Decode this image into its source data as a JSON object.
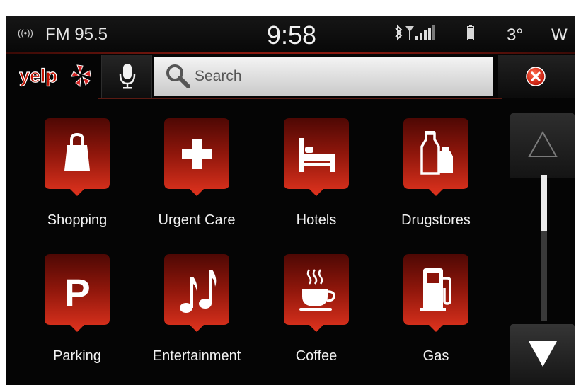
{
  "status_bar": {
    "radio_icon": "radio-signal-icon",
    "station": "FM 95.5",
    "time": "9:58",
    "bluetooth_icon": "bluetooth-icon",
    "signal_icon": "cell-signal-icon",
    "battery_icon": "battery-icon",
    "temperature": "3°",
    "compass": "W"
  },
  "search_row": {
    "logo_text": "yelp",
    "mic_icon": "microphone-icon",
    "search_icon": "magnifier-icon",
    "search_placeholder": "Search",
    "search_value": "",
    "close_icon": "close-x-icon"
  },
  "categories": [
    {
      "label": "Shopping",
      "icon": "shopping-bag-icon"
    },
    {
      "label": "Urgent Care",
      "icon": "medical-cross-icon"
    },
    {
      "label": "Hotels",
      "icon": "bed-icon"
    },
    {
      "label": "Drugstores",
      "icon": "bottles-icon"
    },
    {
      "label": "Parking",
      "icon": "parking-icon"
    },
    {
      "label": "Entertainment",
      "icon": "music-notes-icon"
    },
    {
      "label": "Coffee",
      "icon": "coffee-cup-icon"
    },
    {
      "label": "Gas",
      "icon": "fuel-pump-icon"
    }
  ],
  "scroll": {
    "up_icon": "triangle-up-icon",
    "down_icon": "triangle-down-icon",
    "position_fraction": 0.0
  },
  "colors": {
    "accent_red": "#c8281a",
    "pin_dark_red": "#5e0c06",
    "background": "#050505",
    "label_text": "#f2f2f2"
  }
}
